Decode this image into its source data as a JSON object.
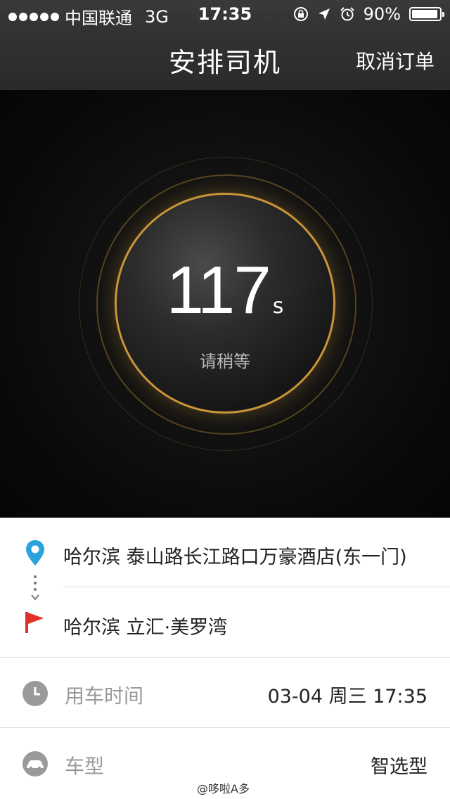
{
  "status_bar": {
    "carrier": "中国联通",
    "network": "3G",
    "time": "17:35",
    "battery": "90%",
    "battery_level": 0.9
  },
  "nav": {
    "title": "安排司机",
    "cancel_label": "取消订单"
  },
  "countdown": {
    "value": "117",
    "unit": "s",
    "wait_text": "请稍等"
  },
  "trip": {
    "start": "哈尔滨 泰山路长江路口万豪酒店(东一门)",
    "end": "哈尔滨 立汇·美罗湾"
  },
  "details": {
    "time_label": "用车时间",
    "time_value": "03-04 周三 17:35",
    "car_label": "车型",
    "car_value": "智选型"
  },
  "watermark": "@哆啦A多",
  "colors": {
    "accent_gold": "#c9953a",
    "pin_blue": "#2aa3dd",
    "flag_red": "#e0312b"
  }
}
